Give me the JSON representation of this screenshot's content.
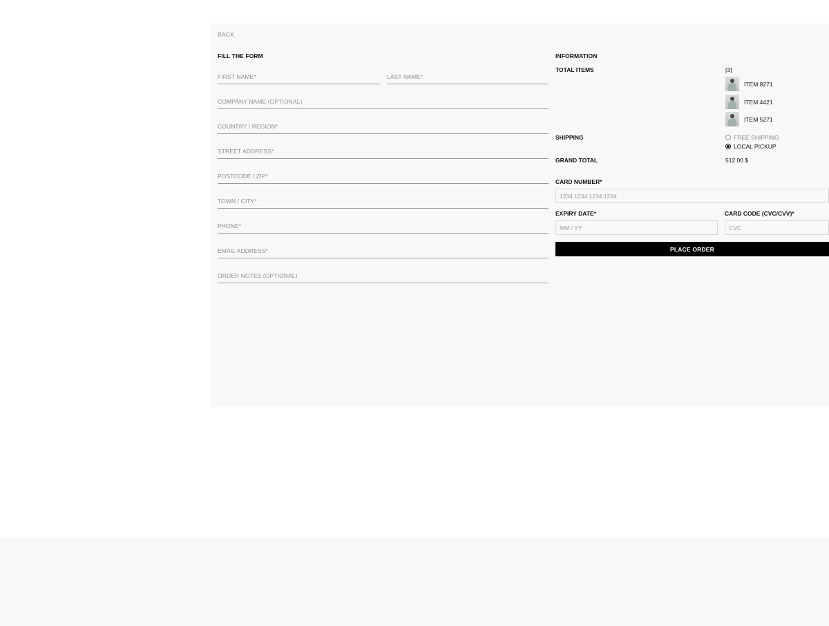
{
  "nav": {
    "back_label": "BACK"
  },
  "form": {
    "heading": "FILL THE FORM",
    "fields": {
      "first_name": "FIRST NAME*",
      "last_name": "LAST NAME*",
      "company": "COMPANY NAME (OPTIONAL)",
      "country": "COUNTRY / REGION*",
      "street": "STREET ADDRESS*",
      "postcode": "POSTCODE / ZIP*",
      "town": "TOWN / CITY*",
      "phone": "PHONE*",
      "email": "EMAIL ADDRESS*",
      "notes": "ORDER NOTES (OPTIONAL)"
    }
  },
  "summary": {
    "heading": "INFORMATION",
    "total_items_label": "TOTAL ITEMS",
    "total_items_value": "[3]",
    "items": [
      "ITEM 8271",
      "ITEM 4421",
      "ITEM 5271"
    ],
    "shipping_label": "SHIPPING",
    "shipping_options": [
      {
        "label": "FREE SHIPPING",
        "selected": false
      },
      {
        "label": "LOCAL PICKUP",
        "selected": true
      }
    ],
    "grand_total_label": "GRAND TOTAL",
    "grand_total_value": "512.00 $"
  },
  "payment": {
    "card_number_label": "CARD NUMBER*",
    "card_number_placeholder": "1234 1234 1234 1234",
    "expiry_label": "EXPIRY DATE*",
    "expiry_placeholder": "MM / YY",
    "cvc_label": "CARD CODE (CVC/CVV)*",
    "cvc_placeholder": "CVC",
    "submit_label": "PLACE ORDER"
  },
  "colors": {
    "button_bg": "#000000",
    "panel_bg": "#f8f8f8"
  }
}
